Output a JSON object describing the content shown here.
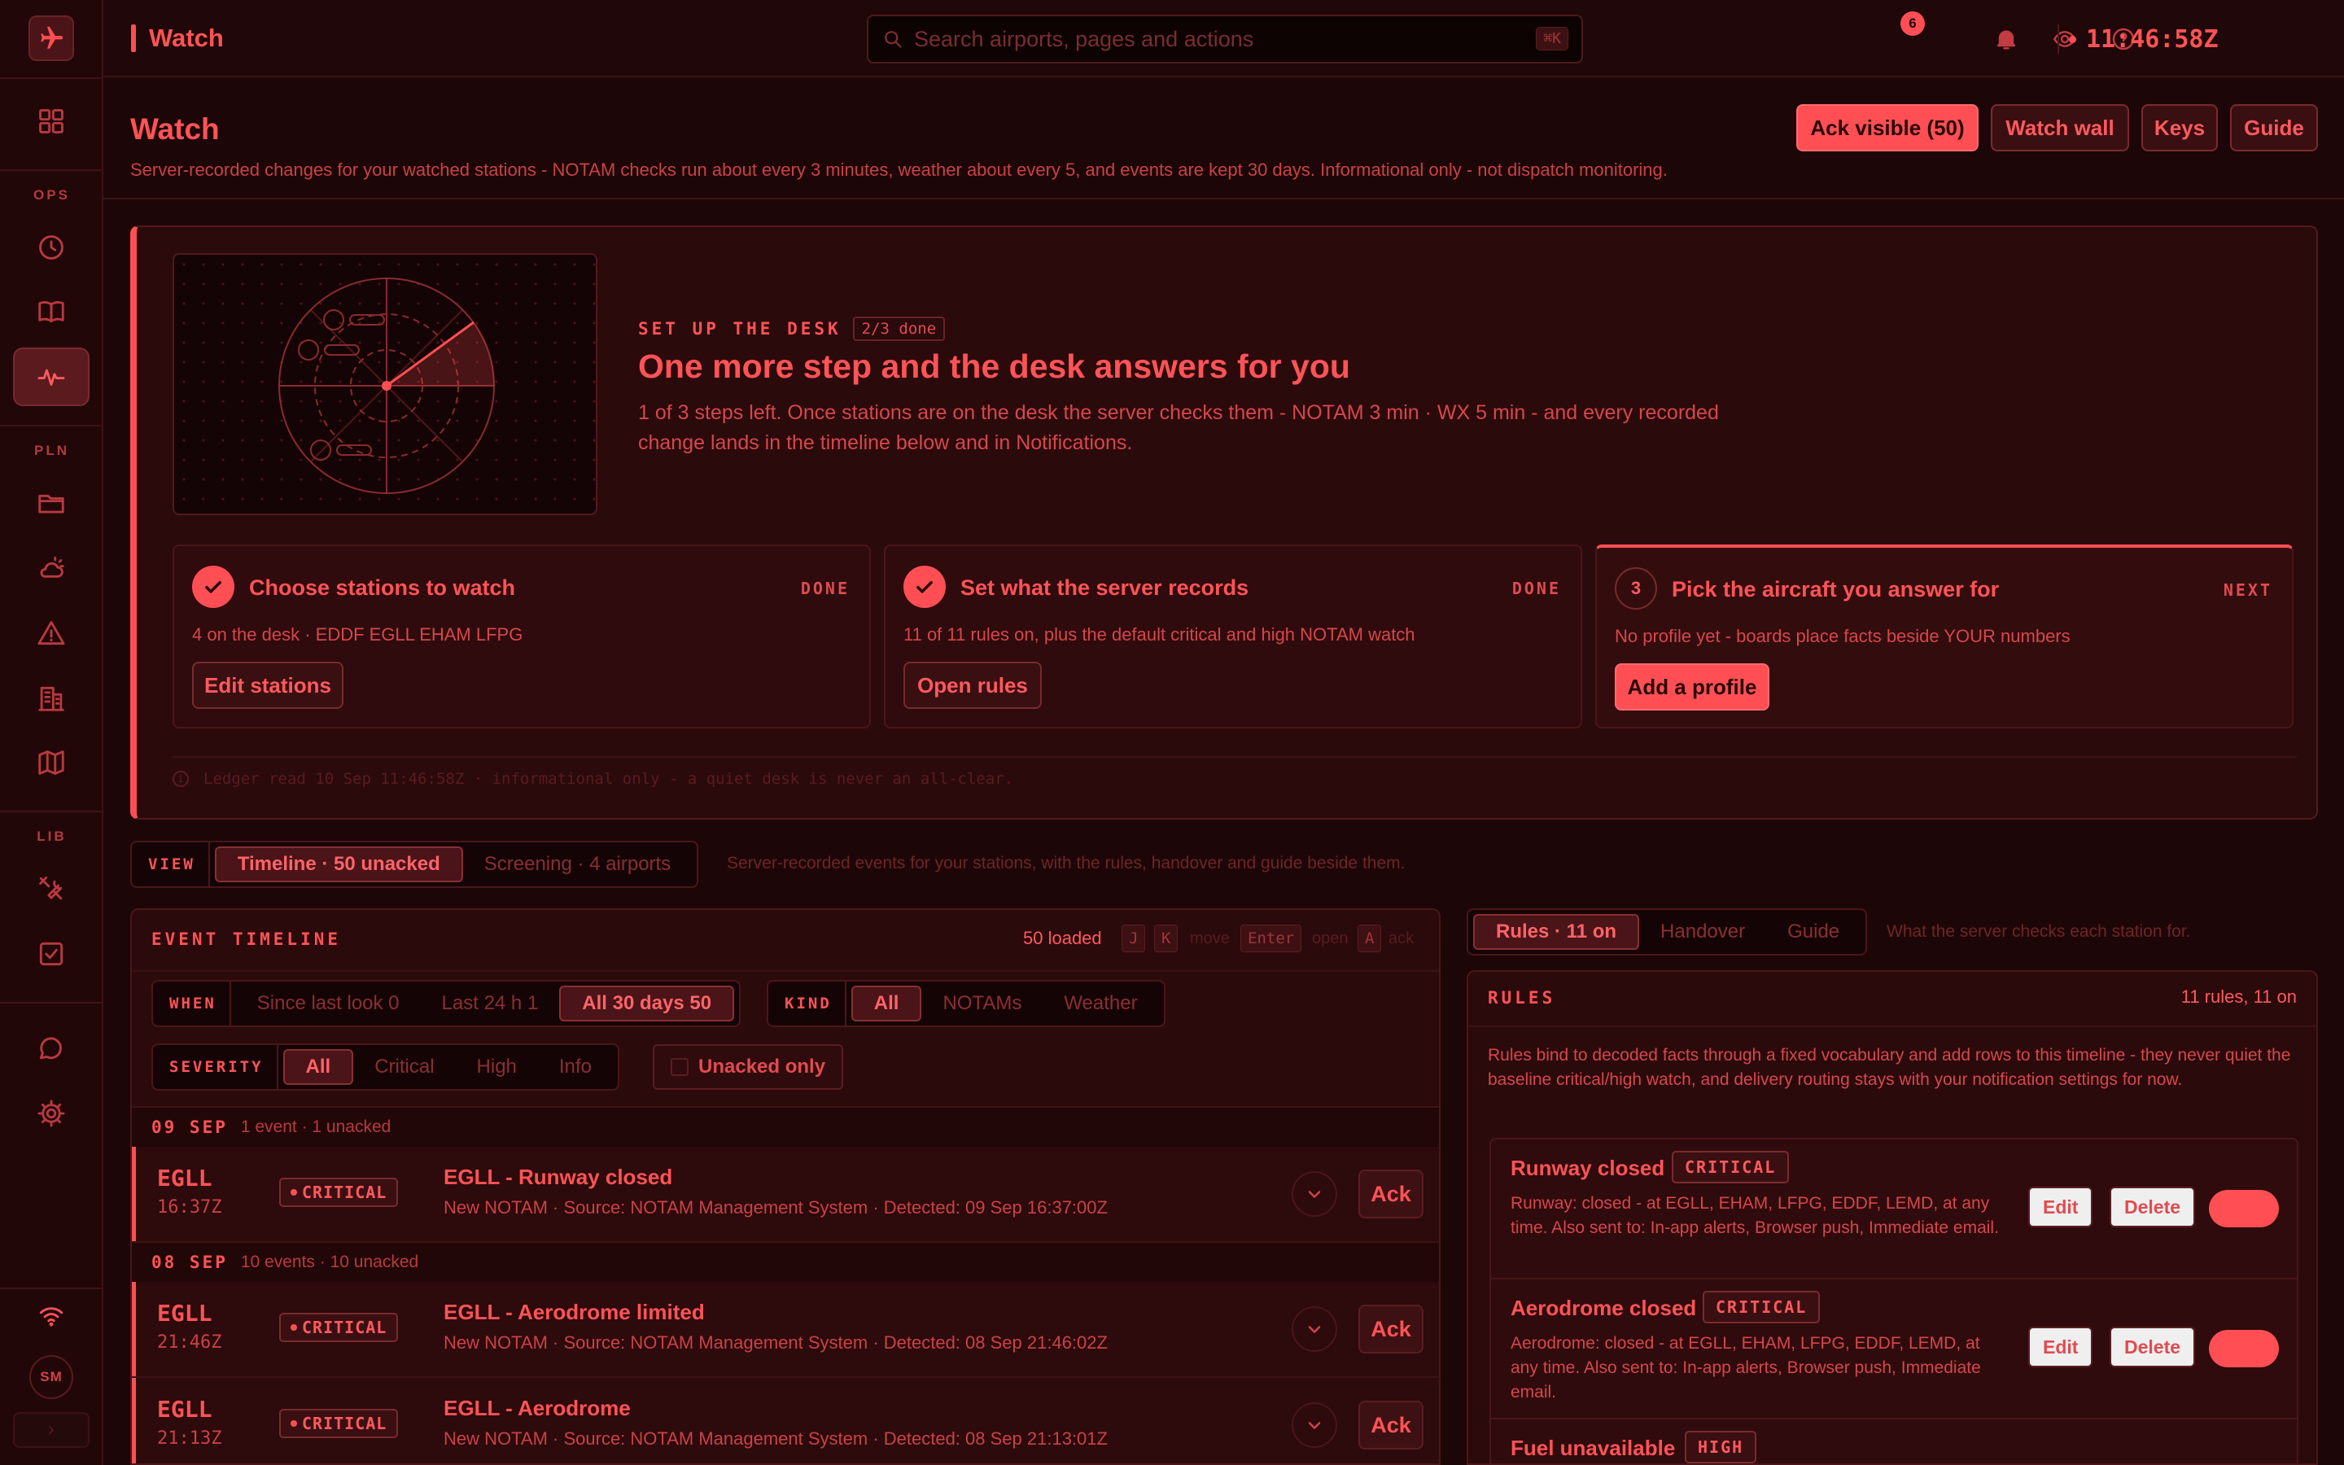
{
  "topbar": {
    "title": "Watch",
    "search_placeholder": "Search airports, pages and actions",
    "search_shortcut": "⌘K",
    "notifications_count": "6",
    "clock": "11:46:58Z"
  },
  "rail": {
    "sections": {
      "ops": "OPS",
      "pln": "PLN",
      "lib": "LIB"
    },
    "avatar": "SM"
  },
  "header": {
    "title": "Watch",
    "subtitle": "Server-recorded changes for your watched stations - NOTAM checks run about every 3 minutes, weather about every 5, and events are kept 30 days. Informational only - not dispatch monitoring.",
    "buttons": {
      "ack_visible": "Ack visible (50)",
      "watch_wall": "Watch wall",
      "keys": "Keys",
      "guide": "Guide"
    }
  },
  "setup": {
    "kicker": "SET UP THE DESK",
    "progress": "2/3 done",
    "heading": "One more step and the desk answers for you",
    "body": "1 of 3 steps left. Once stations are on the desk the server checks them - NOTAM 3 min · WX 5 min - and every recorded change lands in the timeline below and in Notifications.",
    "steps": [
      {
        "title": "Choose stations to watch",
        "status": "DONE",
        "desc": "4 on the desk · EDDF EGLL EHAM LFPG",
        "button": "Edit stations"
      },
      {
        "title": "Set what the server records",
        "status": "DONE",
        "desc": "11 of 11 rules on, plus the default critical and high NOTAM watch",
        "button": "Open rules"
      },
      {
        "number": "3",
        "title": "Pick the aircraft you answer for",
        "status": "NEXT",
        "desc": "No profile yet - boards place facts beside YOUR numbers",
        "button": "Add a profile"
      }
    ],
    "ledger": "Ledger read 10 Sep 11:46:58Z · informational only - a quiet desk is never an all-clear."
  },
  "view": {
    "label": "VIEW",
    "options": [
      "Timeline · 50 unacked",
      "Screening · 4 airports"
    ],
    "hint": "Server-recorded events for your stations, with the rules, handover and guide beside them."
  },
  "timeline": {
    "title": "EVENT TIMELINE",
    "loaded": "50 loaded",
    "keys": {
      "j": "J",
      "k": "K",
      "move": "move",
      "enter": "Enter",
      "open": "open",
      "a": "A",
      "ack": "ack"
    },
    "filters": {
      "when": {
        "label": "WHEN",
        "options": [
          "Since last look 0",
          "Last 24 h 1",
          "All 30 days 50"
        ]
      },
      "kind": {
        "label": "KIND",
        "options": [
          "All",
          "NOTAMs",
          "Weather"
        ]
      },
      "severity": {
        "label": "SEVERITY",
        "options": [
          "All",
          "Critical",
          "High",
          "Info"
        ]
      },
      "unacked_only": "Unacked only"
    },
    "days": [
      {
        "date": "09 SEP",
        "count": "1 event · 1 unacked"
      },
      {
        "date": "08 SEP",
        "count": "10 events · 10 unacked"
      }
    ],
    "events": [
      {
        "station": "EGLL",
        "time": "16:37Z",
        "severity": "CRITICAL",
        "title": "EGLL - Runway closed",
        "meta": "New NOTAM · Source: NOTAM Management System · Detected: 09 Sep 16:37:00Z",
        "ack": "Ack"
      },
      {
        "station": "EGLL",
        "time": "21:46Z",
        "severity": "CRITICAL",
        "title": "EGLL - Aerodrome limited",
        "meta": "New NOTAM · Source: NOTAM Management System · Detected: 08 Sep 21:46:02Z",
        "ack": "Ack"
      },
      {
        "station": "EGLL",
        "time": "21:13Z",
        "severity": "CRITICAL",
        "title": "EGLL - Aerodrome",
        "meta": "New NOTAM · Source: NOTAM Management System · Detected: 08 Sep 21:13:01Z",
        "ack": "Ack"
      }
    ]
  },
  "side": {
    "tabs": [
      "Rules · 11 on",
      "Handover",
      "Guide"
    ],
    "hint": "What the server checks each station for."
  },
  "rules": {
    "title": "RULES",
    "count": "11 rules, 11 on",
    "description": "Rules bind to decoded facts through a fixed vocabulary and add rows to this timeline - they never quiet the baseline critical/high watch, and delivery routing stays with your notification settings for now.",
    "items": [
      {
        "name": "Runway closed",
        "severity": "CRITICAL",
        "desc": "Runway: closed - at EGLL, EHAM, LFPG, EDDF, LEMD, at any time. Also sent to: In-app alerts, Browser push, Immediate email.",
        "edit": "Edit",
        "delete": "Delete"
      },
      {
        "name": "Aerodrome closed",
        "severity": "CRITICAL",
        "desc": "Aerodrome: closed - at EGLL, EHAM, LFPG, EDDF, LEMD, at any time. Also sent to: In-app alerts, Browser push, Immediate email.",
        "edit": "Edit",
        "delete": "Delete"
      },
      {
        "name": "Fuel unavailable",
        "severity": "HIGH"
      }
    ]
  }
}
